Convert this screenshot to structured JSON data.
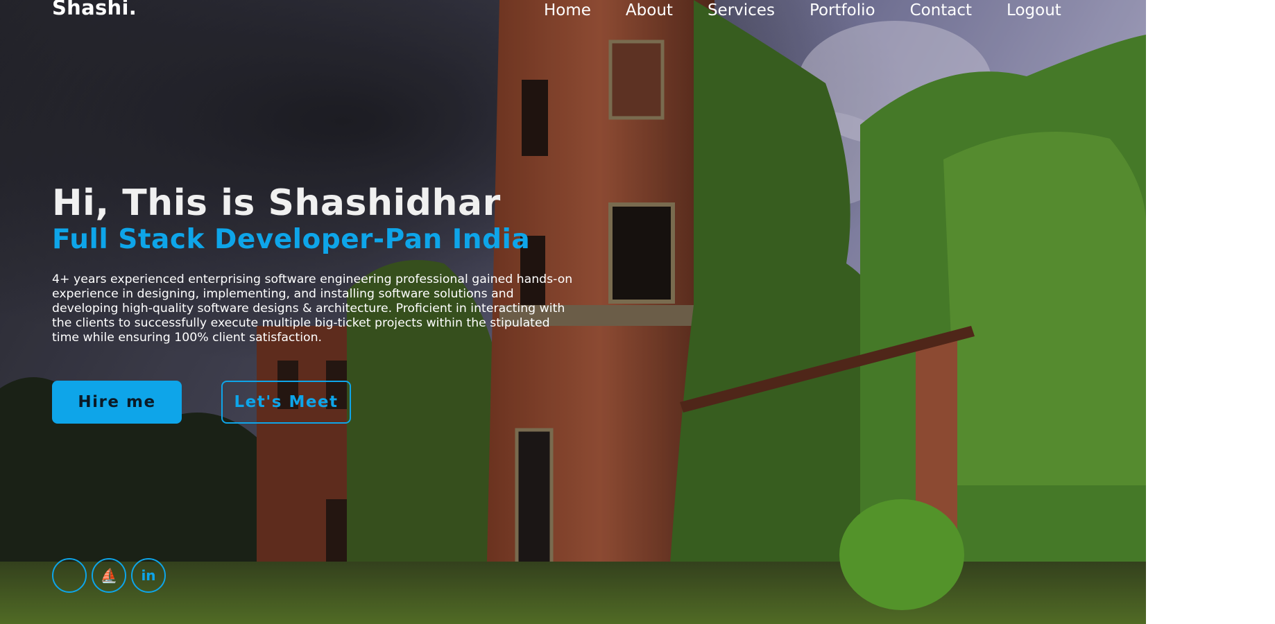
{
  "header": {
    "brand": "Shashi.",
    "nav": [
      {
        "label": "Home"
      },
      {
        "label": "About"
      },
      {
        "label": "Services"
      },
      {
        "label": "Portfolio"
      },
      {
        "label": "Contact"
      },
      {
        "label": "Logout"
      }
    ]
  },
  "hero": {
    "greeting": "Hi, This is Shashidhar",
    "role": "Full Stack Developer-Pan India",
    "bio": "4+ years experienced enterprising software engineering professional gained hands-on experience in designing, implementing, and installing software solutions and developing high-quality software designs & architecture. Proficient in interacting with the clients to successfully execute multiple big-ticket projects within the stipulated time while ensuring 100% client satisfaction.",
    "buttons": {
      "hire": "Hire me",
      "meet": "Let's Meet"
    }
  },
  "socials": [
    {
      "icon": "blank-circle-icon",
      "glyph": ""
    },
    {
      "icon": "stack-overflow-icon",
      "glyph": "⛵"
    },
    {
      "icon": "linkedin-icon",
      "glyph": "in"
    }
  ],
  "colors": {
    "accent": "#0ea5e9",
    "text": "#ffffff",
    "page_bg": "#ffffff"
  }
}
